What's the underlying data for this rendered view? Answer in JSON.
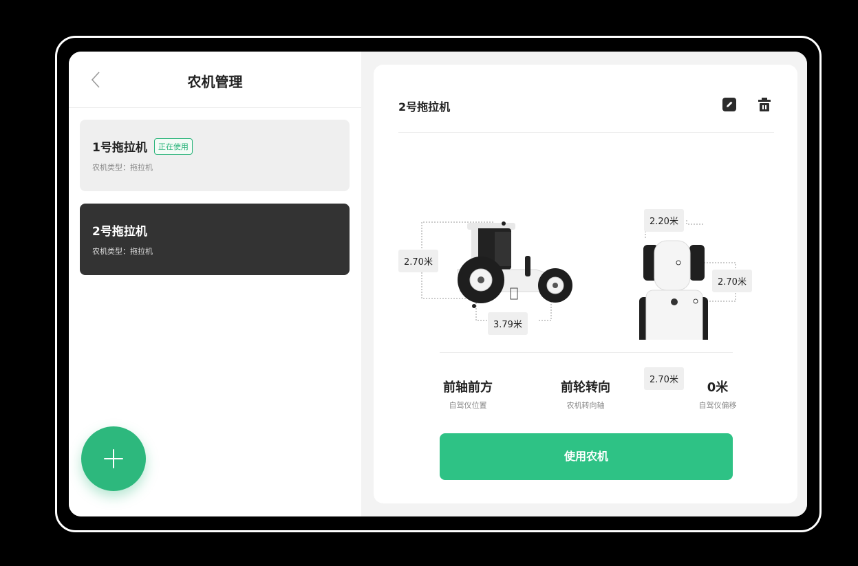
{
  "left_panel": {
    "title": "农机管理",
    "cards": [
      {
        "name": "1号拖拉机",
        "badge": "正在使用",
        "type": "农机类型：拖拉机"
      },
      {
        "name": "2号拖拉机",
        "type": "农机类型：拖拉机"
      }
    ],
    "icons": {
      "back": "chevron-left-icon",
      "add": "plus-icon"
    }
  },
  "detail": {
    "title": "2号拖拉机",
    "icons": {
      "edit": "edit-icon",
      "delete": "trash-icon"
    },
    "dimensions": {
      "side_height": "2.70米",
      "side_length": "3.79米",
      "top_front_width": "2.20米",
      "top_length": "2.70米",
      "top_rear_width": "2.70米"
    },
    "stats": [
      {
        "value": "前轴前方",
        "label": "自驾仪位置"
      },
      {
        "value": "前轮转向",
        "label": "农机转向轴"
      },
      {
        "value": "0米",
        "label": "自驾仪偏移"
      }
    ],
    "use_button": "使用农机"
  },
  "colors": {
    "accent": "#2ec285",
    "selected_card": "#333333",
    "badge": "#2ab47a"
  }
}
